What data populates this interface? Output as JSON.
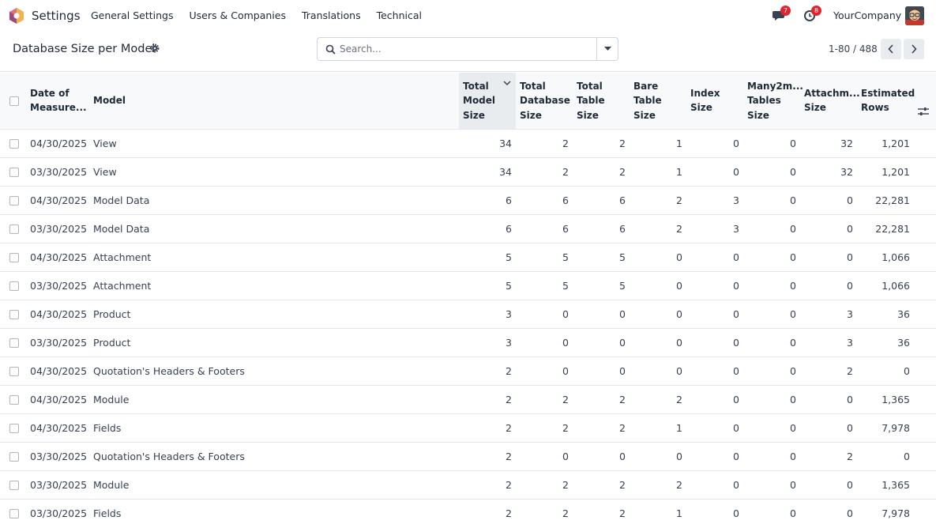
{
  "navbar": {
    "app_name": "Settings",
    "menu": [
      "General Settings",
      "Users & Companies",
      "Translations",
      "Technical"
    ],
    "messages_badge": "7",
    "activity_badge": "8",
    "company": "YourCompany"
  },
  "control": {
    "title": "Database Size per Model",
    "search_placeholder": "Search...",
    "pager": "1-80 / 488"
  },
  "table": {
    "columns": [
      "Date of Measure...",
      "Model",
      "Total Model Size",
      "Total Database Size",
      "Total Table Size",
      "Bare Table Size",
      "Index Size",
      "Many2m... Tables Size",
      "Attachm... Size",
      "Estimated Rows"
    ],
    "sorted_column": "Total Model Size",
    "rows": [
      [
        "04/30/2025",
        "View",
        "34",
        "2",
        "2",
        "1",
        "0",
        "0",
        "32",
        "1,201"
      ],
      [
        "03/30/2025",
        "View",
        "34",
        "2",
        "2",
        "1",
        "0",
        "0",
        "32",
        "1,201"
      ],
      [
        "04/30/2025",
        "Model Data",
        "6",
        "6",
        "6",
        "2",
        "3",
        "0",
        "0",
        "22,281"
      ],
      [
        "03/30/2025",
        "Model Data",
        "6",
        "6",
        "6",
        "2",
        "3",
        "0",
        "0",
        "22,281"
      ],
      [
        "04/30/2025",
        "Attachment",
        "5",
        "5",
        "5",
        "0",
        "0",
        "0",
        "0",
        "1,066"
      ],
      [
        "03/30/2025",
        "Attachment",
        "5",
        "5",
        "5",
        "0",
        "0",
        "0",
        "0",
        "1,066"
      ],
      [
        "04/30/2025",
        "Product",
        "3",
        "0",
        "0",
        "0",
        "0",
        "0",
        "3",
        "36"
      ],
      [
        "03/30/2025",
        "Product",
        "3",
        "0",
        "0",
        "0",
        "0",
        "0",
        "3",
        "36"
      ],
      [
        "04/30/2025",
        "Quotation's Headers & Footers",
        "2",
        "0",
        "0",
        "0",
        "0",
        "0",
        "2",
        "0"
      ],
      [
        "04/30/2025",
        "Module",
        "2",
        "2",
        "2",
        "2",
        "0",
        "0",
        "0",
        "1,365"
      ],
      [
        "04/30/2025",
        "Fields",
        "2",
        "2",
        "2",
        "1",
        "0",
        "0",
        "0",
        "7,978"
      ],
      [
        "03/30/2025",
        "Quotation's Headers & Footers",
        "2",
        "0",
        "0",
        "0",
        "0",
        "0",
        "2",
        "0"
      ],
      [
        "03/30/2025",
        "Module",
        "2",
        "2",
        "2",
        "2",
        "0",
        "0",
        "0",
        "1,365"
      ],
      [
        "03/30/2025",
        "Fields",
        "2",
        "2",
        "2",
        "1",
        "0",
        "0",
        "0",
        "7,978"
      ]
    ]
  },
  "colors": {
    "accent": "#714b67",
    "badge": "#e0242f",
    "header_bg": "#f8f9fa"
  }
}
